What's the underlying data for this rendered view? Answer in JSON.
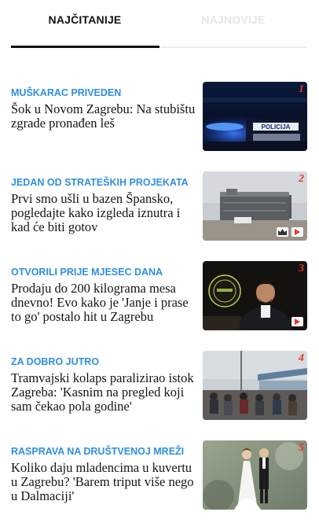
{
  "tabs": [
    {
      "label": "NAJČITANIJE",
      "active": true
    },
    {
      "label": "NAJNOVIJE",
      "active": false
    }
  ],
  "colors": {
    "accent": "#2f8fdf",
    "rank": "#e6332a",
    "text": "#141414"
  },
  "articles": [
    {
      "kicker": "MUŠKARAC PRIVEDEN",
      "title": "Šok u Novom Zagrebu: Na stubištu zgrade pronađen leš",
      "rank": "1",
      "image": "police-car-photo",
      "badges": []
    },
    {
      "kicker": "JEDAN OD STRATEŠKIH PROJEKATA",
      "title": "Prvi smo ušli u bazen Špansko, pogledajte kako izgleda iznutra i kad će biti gotov",
      "rank": "2",
      "image": "construction-site-photo",
      "badges": [
        "gallery-icon",
        "video-play-icon"
      ]
    },
    {
      "kicker": "OTVORILI PRIJE MJESEC DANA",
      "title": "Prodaju do 200 kilograma mesa dnevno! Evo kako je 'Janje i prase to go' postalo hit u Zagrebu",
      "rank": "3",
      "image": "restaurant-owner-photo",
      "badges": [
        "video-play-icon"
      ]
    },
    {
      "kicker": "ZA DOBRO JUTRO",
      "title": "Tramvajski kolaps paralizirao istok Zagreba: 'Kasnim na pregled koji sam čekao pola godine'",
      "rank": "4",
      "image": "tram-stop-crowd-photo",
      "badges": []
    },
    {
      "kicker": "RASPRAVA NA DRUŠTVENOJ MREŽI",
      "title": "Koliko daju mladencima u kuvertu u Zagrebu? 'Barem triput više nego u Dalmaciji'",
      "rank": "5",
      "image": "wedding-cake-topper-photo",
      "badges": []
    }
  ]
}
